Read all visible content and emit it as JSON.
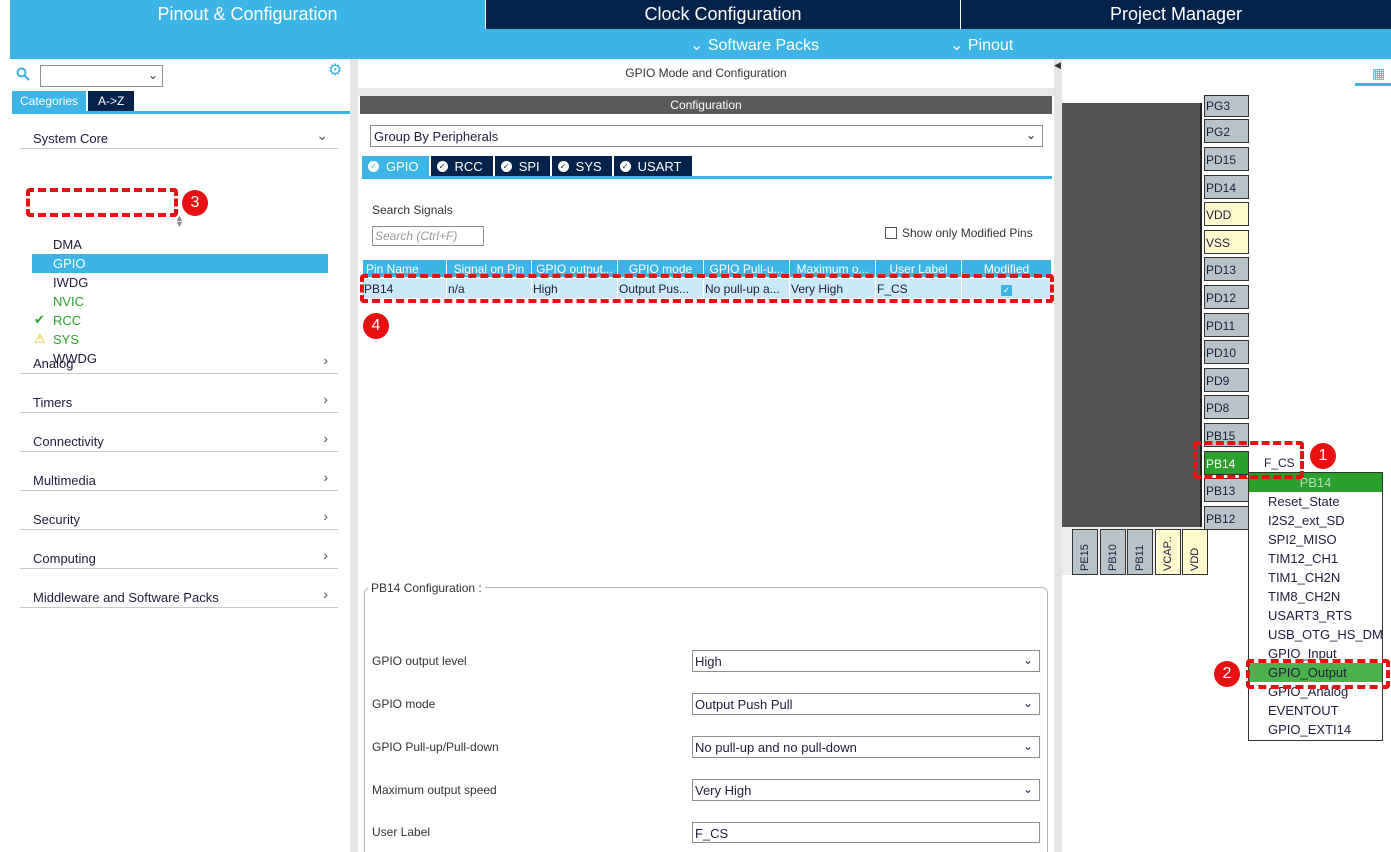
{
  "top_tabs": [
    "Pinout & Configuration",
    "Clock Configuration",
    "Project Manager"
  ],
  "subbar": {
    "software_packs": "Software Packs",
    "pinout": "Pinout"
  },
  "left": {
    "tabs": [
      "Categories",
      "A->Z"
    ],
    "sections": [
      "System Core",
      "Analog",
      "Timers",
      "Connectivity",
      "Multimedia",
      "Security",
      "Computing",
      "Middleware and Software Packs"
    ],
    "system_core_items": [
      "DMA",
      "GPIO",
      "IWDG",
      "NVIC",
      "RCC",
      "SYS",
      "WWDG"
    ]
  },
  "middle": {
    "title": "GPIO Mode and Configuration",
    "config_bar": "Configuration",
    "group_by": "Group By Peripherals",
    "periph_tabs": [
      "GPIO",
      "RCC",
      "SPI",
      "SYS",
      "USART"
    ],
    "search_label": "Search Signals",
    "search_placeholder": "Search (Ctrl+F)",
    "show_modified": "Show only Modified Pins",
    "table": {
      "headers": [
        "Pin Name",
        "Signal on Pin",
        "GPIO output...",
        "GPIO mode",
        "GPIO Pull-u...",
        "Maximum o...",
        "User Label",
        "Modified"
      ],
      "row": [
        "PB14",
        "n/a",
        "High",
        "Output Pus...",
        "No pull-up a...",
        "Very High",
        "F_CS"
      ]
    },
    "pb14_config": {
      "title": "PB14 Configuration :",
      "fields": [
        {
          "label": "GPIO output level",
          "value": "High"
        },
        {
          "label": "GPIO mode",
          "value": "Output Push Pull"
        },
        {
          "label": "GPIO Pull-up/Pull-down",
          "value": "No pull-up and no pull-down"
        },
        {
          "label": "Maximum output speed",
          "value": "Very High"
        },
        {
          "label": "User Label",
          "value": "F_CS"
        }
      ]
    }
  },
  "right": {
    "pins_right": [
      "PG3",
      "PG2",
      "PD15",
      "PD14",
      "VDD",
      "VSS",
      "PD13",
      "PD12",
      "PD11",
      "PD10",
      "PD9",
      "PD8",
      "PB15",
      "PB14",
      "PB13",
      "PB12"
    ],
    "pins_bottom": [
      "PE15",
      "PB10",
      "PB11",
      "VCAP..",
      "VDD"
    ],
    "pin_label": "F_CS",
    "context_menu": {
      "header": "PB14",
      "items": [
        "Reset_State",
        "I2S2_ext_SD",
        "SPI2_MISO",
        "TIM12_CH1",
        "TIM1_CH2N",
        "TIM8_CH2N",
        "USART3_RTS",
        "USB_OTG_HS_DM",
        "GPIO_Input",
        "GPIO_Output",
        "GPIO_Analog",
        "EVENTOUT",
        "GPIO_EXTI14"
      ]
    }
  },
  "annotations": [
    "1",
    "2",
    "3",
    "4"
  ],
  "colors": {
    "accent": "#3cb4e6",
    "navy": "#03234b",
    "pin_active": "#2ba02b",
    "annotation": "#e81010"
  }
}
